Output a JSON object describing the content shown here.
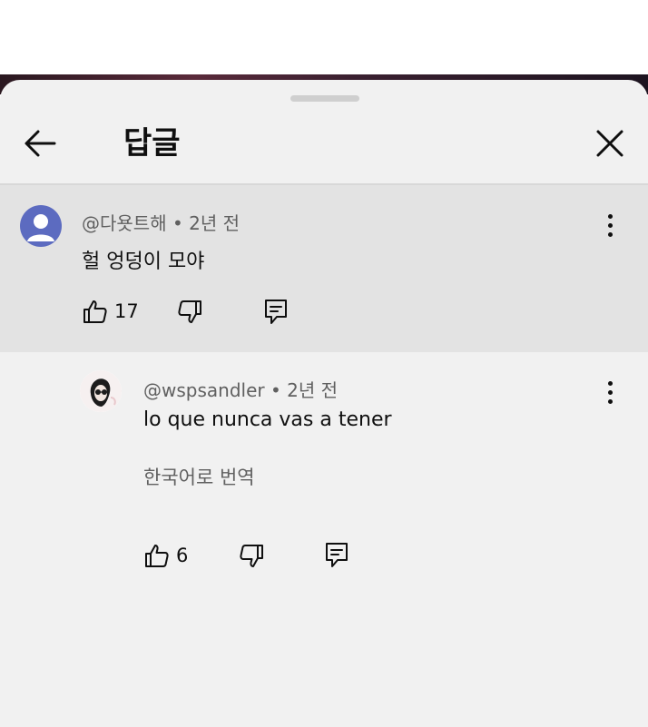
{
  "header": {
    "title": "답글",
    "back_icon": "arrow-left-icon",
    "close_icon": "close-icon"
  },
  "parent_comment": {
    "author": "@다욧트해",
    "time": "2년 전",
    "text": "헐 엉덩이 모야",
    "likes": "17",
    "avatar_color": "#5c6bc0"
  },
  "reply": {
    "author": "@wspsandler",
    "time": "2년 전",
    "text": "lo que nunca vas a tener",
    "translate_label": "한국어로 번역",
    "likes": "6"
  },
  "icons": {
    "like": "thumbs-up-icon",
    "dislike": "thumbs-down-icon",
    "reply": "reply-icon",
    "more": "more-vert-icon"
  }
}
